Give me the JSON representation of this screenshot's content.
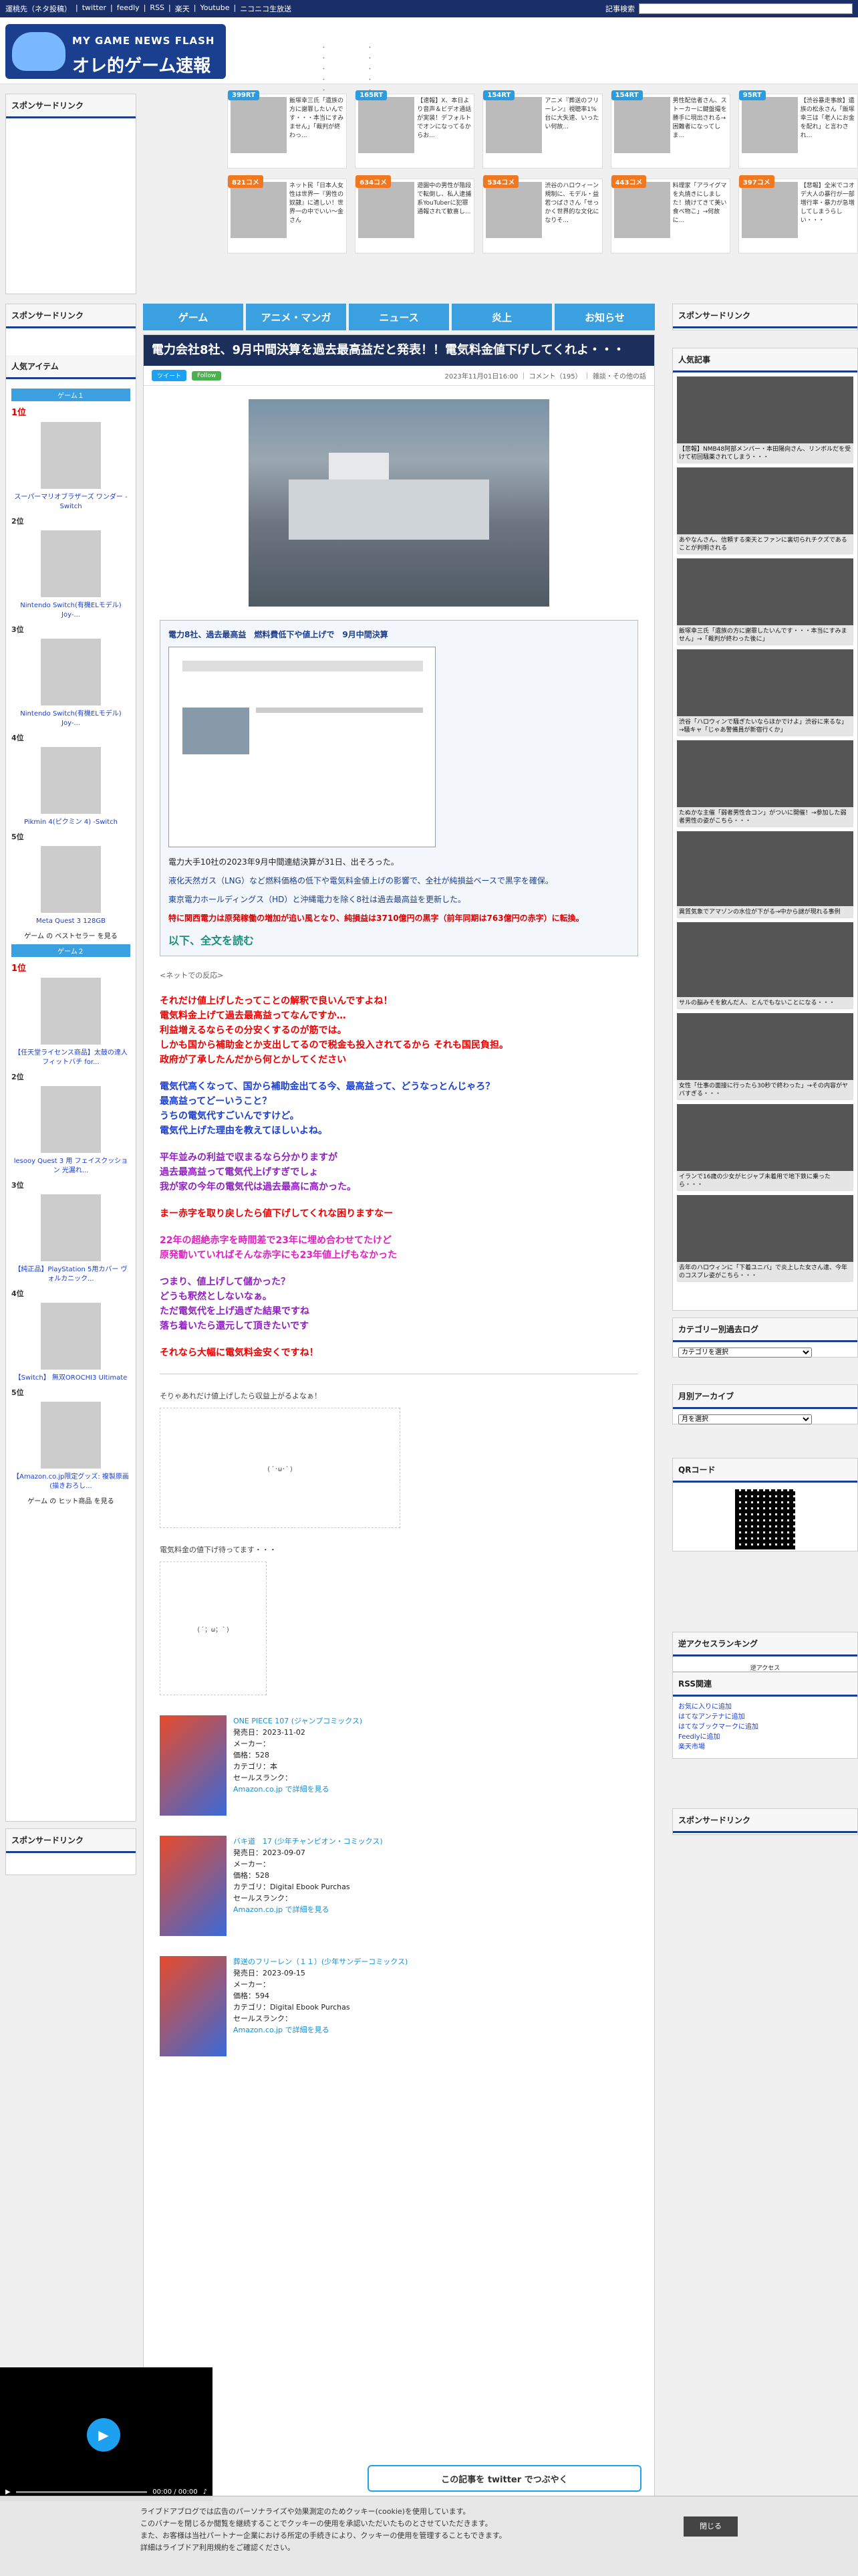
{
  "topbar": {
    "links": [
      "運桃先（ネタ投稿）",
      "twitter",
      "feedly",
      "RSS",
      "楽天",
      "Youtube",
      "ニコニコ生放送"
    ],
    "search_label": "記事検索"
  },
  "logo": {
    "sub": "MY GAME NEWS FLASH",
    "main": "オレ的ゲーム速報@JIN"
  },
  "header_news": {
    "col1": [
      "・",
      "・",
      "・",
      "・",
      "・",
      "・"
    ],
    "col2": [
      "・",
      "・",
      "・",
      "・",
      "・",
      "・"
    ]
  },
  "left": {
    "sponsor": "スポンサードリンク",
    "sponsor2": "スポンサードリンク",
    "popular": "人気アイテム",
    "games_cat1": "ゲーム１",
    "games_cat2": "ゲーム２",
    "rank1": [
      {
        "pos": "1位",
        "name": "スーパーマリオブラザーズ ワンダー -Switch"
      },
      {
        "pos": "2位",
        "name": "Nintendo Switch(有機ELモデル) Joy-..."
      },
      {
        "pos": "3位",
        "name": "Nintendo Switch(有機ELモデル) Joy-..."
      },
      {
        "pos": "4位",
        "name": "Pikmin 4(ピクミン 4) -Switch"
      },
      {
        "pos": "5位",
        "name": "Meta Quest 3 128GB"
      }
    ],
    "rank1_more": "ゲーム の ベストセラー を見る",
    "rank2": [
      {
        "pos": "1位",
        "name": "【任天堂ライセンス商品】太鼓の達人 フィットバチ for..."
      },
      {
        "pos": "2位",
        "name": "lesooy Quest 3 用 フェイスクッション 光漏れ..."
      },
      {
        "pos": "3位",
        "name": "【純正品】PlayStation 5用カバー ヴォルカニック..."
      },
      {
        "pos": "4位",
        "name": "【Switch】 無双OROCHI3 Ultimate"
      },
      {
        "pos": "5位",
        "name": "【Amazon.co.jp限定グッズ: 複製原画(描きおろし..."
      }
    ],
    "rank2_more": "ゲーム の ヒット商品 を見る"
  },
  "ads": [
    {
      "badge": "399RT",
      "text": "飯塚幸三氏「遺族の方に謝罪したいんです・・・本当にすみません」「裁判が終わっ..."
    },
    {
      "badge": "165RT",
      "text": "【速報】X、本日より音声＆ビデオ通話が実装！デフォルトでオンになってるからお..."
    },
    {
      "badge": "154RT",
      "text": "アニメ『葬送のフリーレン』視聴率1%台に大失速、いったい何故..."
    },
    {
      "badge": "154RT",
      "text": "男性配信者さん、ストーカーに鍵盤撮を勝手に現出される→困難者になってしま..."
    },
    {
      "badge": "95RT",
      "text": "【渋谷暴走事故】遺族の松永さん「飯塚幸三は「老人にお金を配れ」と言わされ..."
    },
    {
      "badge": "821コメ",
      "text": "ネット民「日本人女性は世界一『男性の奴隷』に適しい！世界一の中でいい～金さん"
    },
    {
      "badge": "634コメ",
      "text": "遊園中の男性が階段で転倒し、私人逮捕系YouTuberに犯罪通報されて歓喜し..."
    },
    {
      "badge": "534コメ",
      "text": "渋谷のハロウィーン規制に、モデル・益若つばささん「せっかく世界的な文化になりそ..."
    },
    {
      "badge": "443コメ",
      "text": "料理家「アライグマを丸焼きにしました！焼けてきて美い食べ物こ」→何故に..."
    },
    {
      "badge": "397コメ",
      "text": "【悲報】全米でコオデ大人の暴行が一部増行率・暴力が急増してしまうらしい・・・"
    }
  ],
  "nav": [
    "ゲーム",
    "アニメ・マンガ",
    "ニュース",
    "炎上",
    "お知らせ"
  ],
  "article": {
    "title": "電力会社8社、9月中間決算を過去最高益だと発表！！電気料金値下げしてくれよ・・・",
    "tweet": "ツイート",
    "follow": "Follow",
    "meta": "2023年11月01日16:00 ｜ コメント（195） ｜ 雑談・その他の話",
    "quote": {
      "heading": "電力8社、過去最高益　燃料費低下や値上げで　9月中間決算",
      "p1": "電力大手10社の2023年9月中間連結決算が31日、出そろった。",
      "p2": "液化天然ガス（LNG）など燃料価格の低下や電気料金値上げの影響で、全社が純損益ベースで黒字を確保。",
      "p3": "東京電力ホールディングス（HD）と沖縄電力を除く8社は過去最高益を更新した。",
      "p4": "特に関西電力は原発稼働の増加が追い風となり、純損益は3710億円の黒字（前年同期は763億円の赤字）に転換。",
      "more": "以下、全文を読む"
    },
    "comments_label": "<ネットでの反応>",
    "comments": [
      {
        "c": "c-red",
        "t": "それだけ値上げしたってことの解釈で良いんですよね！"
      },
      {
        "c": "c-red",
        "t": "電気料金上げて過去最高益ってなんですか…"
      },
      {
        "c": "c-red",
        "t": "利益増えるならその分安くするのが筋では。"
      },
      {
        "c": "c-red",
        "t": "しかも国から補助金とか支出してるので税金も投入されてるから それも国民負担。"
      },
      {
        "c": "c-red",
        "t": "政府が了承したんだから何とかしてください"
      },
      {
        "c": "c-blue",
        "t": "電気代高くなって、国から補助金出てる今、最高益って、どうなっとんじゃろ？"
      },
      {
        "c": "c-blue",
        "t": "最高益ってどーいうこと？"
      },
      {
        "c": "c-blue",
        "t": "うちの電気代すごいんですけど。"
      },
      {
        "c": "c-blue",
        "t": "電気代上げた理由を教えてほしいよね。"
      },
      {
        "c": "c-purple",
        "t": "平年並みの利益で収まるなら分かりますが"
      },
      {
        "c": "c-purple",
        "t": "過去最高益って電気代上げすぎでしょ"
      },
      {
        "c": "c-purple",
        "t": "我が家の今年の電気代は過去最高に高かった。"
      },
      {
        "c": "c-red",
        "t": "まー赤字を取り戻したら値下げしてくれな困りますなー"
      },
      {
        "c": "c-mag",
        "t": "22年の超絶赤字を時間差で23年に埋め合わせてたけど"
      },
      {
        "c": "c-mag",
        "t": "原発動いていればそんな赤字にも23年値上げもなかった"
      },
      {
        "c": "c-purple",
        "t": "つまり、値上げして儲かった？"
      },
      {
        "c": "c-purple",
        "t": "どうも釈然としないなぁ。"
      },
      {
        "c": "c-purple",
        "t": "ただ電気代を上げ過ぎた結果ですね"
      },
      {
        "c": "c-purple",
        "t": "落ち着いたら還元して頂きたいです"
      },
      {
        "c": "c-red",
        "t": "それなら大幅に電気料金安くですね！"
      }
    ],
    "aa1_label": "そりゃあれだけ値上げしたら収益上がるよなぁ！",
    "aa2_label": "電気料金の値下げ待ってます・・・",
    "products": [
      {
        "title": "ONE PIECE 107 (ジャンプコミックス)",
        "date": "発売日：2023-11-02",
        "maker": "メーカー：",
        "price": "価格：528",
        "cat": "カテゴリ：本",
        "rank": "セールスランク：",
        "link": "Amazon.co.jp で詳細を見る"
      },
      {
        "title": "バキ道　17 (少年チャンピオン・コミックス)",
        "date": "発売日：2023-09-07",
        "maker": "メーカー：",
        "price": "価格：528",
        "cat": "カテゴリ：Digital Ebook Purchas",
        "rank": "セールスランク：",
        "link": "Amazon.co.jp で詳細を見る"
      },
      {
        "title": "葬送のフリーレン（１１）(少年サンデーコミックス)",
        "date": "発売日：2023-09-15",
        "maker": "メーカー：",
        "price": "価格：594",
        "cat": "カテゴリ：Digital Ebook Purchas",
        "rank": "セールスランク：",
        "link": "Amazon.co.jp で詳細を見る"
      }
    ],
    "tw_banner": "この記事を twitter でつぶやく"
  },
  "right": {
    "sponsor": "スポンサードリンク",
    "popular": "人気記事",
    "pop_items": [
      "【悲報】NMB48阿部メンバー・本田陽向さん、リンボルだを受けて初回騒薬されてしまう・・・",
      "あやなんさん、信頼する楽天とファンに裏切られチクズであることが判明される",
      "飯塚幸三氏「遺族の方に謝罪したいんです・・・本当にすみません」→「裁判が終わった後に」",
      "渋谷「ハロウィンで騒ぎたいならほかでけよ」渋谷に来るな」→騒キャ「じゃあ警備員が新宿行くか」",
      "たぬかな主催「弱者男性合コン」がついに開催！→参加した弱者男性の姿がこちら・・・",
      "異質気象でアマゾンの水位が下がる→中から謎が現れる事例",
      "サルの脳みそを飲んだ人、とんでもないことになる・・・",
      "女性「仕事の面接に行ったら30秒で終わった」→その内容がヤバすぎる・・・",
      "イランで16歳の少女がヒジャブ未着用で地下鉄に乗ったら・・・",
      "去年のハロウィンに「下着ユニバ」で炎上した女さん達、今年のコスプレ姿がこちら・・・"
    ],
    "archive_cat": "カテゴリー別過去ログ",
    "cat_select": "カテゴリを選択",
    "archive_month": "月別アーカイブ",
    "month_select": "月を選択",
    "qr": "QRコード",
    "reverse": "逆アクセスランキング",
    "reverse_link": "逆アクセス",
    "rss": "RSS関連",
    "rss_links": [
      "お気に入りに追加",
      "はてなアンテナに追加",
      "はてなブックマークに追加",
      "Feedlyに追加",
      "楽天市場"
    ],
    "sponsor2": "スポンサードリンク"
  },
  "video": {
    "time": "00:00 / 00:00"
  },
  "cookie": {
    "l1": "ライブドアブログでは広告のパーソナライズや効果測定のためクッキー(cookie)を使用しています。",
    "l2": "このバナーを閉じるか閲覧を継続することでクッキーの使用を承認いただいたものとさせていただきます。",
    "l3": "また、お客様は当社パートナー企業における所定の手続きにより、クッキーの使用を管理することもできます。",
    "l4": "詳細はライブドア利用規約をご確認ください。",
    "ok": "閉じる"
  }
}
